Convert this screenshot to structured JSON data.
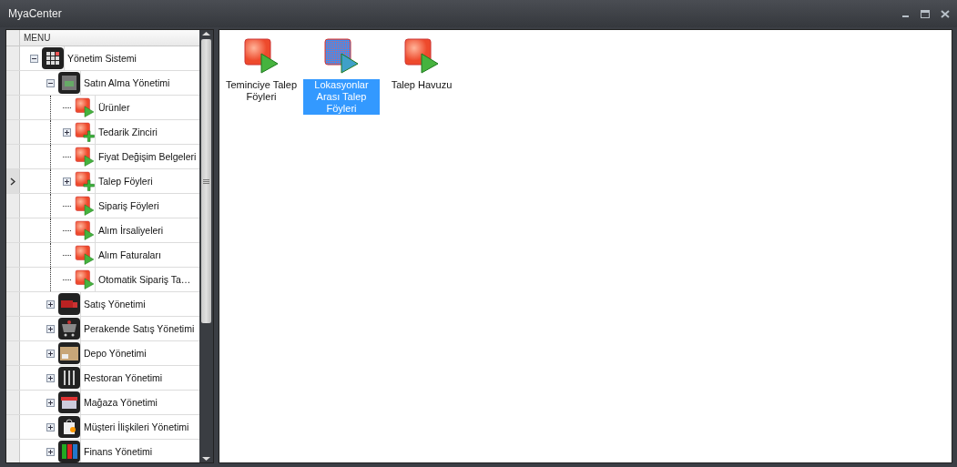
{
  "window": {
    "title": "MyaCenter"
  },
  "menu": {
    "header": "MENU",
    "tree": [
      {
        "label": "Yönetim Sistemi",
        "kind": "module",
        "expanded": true,
        "selected": false,
        "children": [
          {
            "label": "Satın Alma Yönetimi",
            "kind": "module",
            "expanded": true,
            "selected": false,
            "children": [
              {
                "label": "Ürünler",
                "kind": "run",
                "selected": false
              },
              {
                "label": "Tedarik Zinciri",
                "kind": "folder",
                "expanded": false,
                "selected": false
              },
              {
                "label": "Fiyat Değişim Belgeleri",
                "kind": "run",
                "selected": false
              },
              {
                "label": "Talep Föyleri",
                "kind": "folder",
                "expanded": false,
                "selected": true
              },
              {
                "label": "Sipariş Föyleri",
                "kind": "run",
                "selected": false
              },
              {
                "label": "Alım İrsaliyeleri",
                "kind": "run",
                "selected": false
              },
              {
                "label": "Alım Faturaları",
                "kind": "run",
                "selected": false
              },
              {
                "label": "Otomatik Sipariş Ta…",
                "kind": "run",
                "selected": false
              }
            ]
          },
          {
            "label": "Satış Yönetimi",
            "kind": "module",
            "expanded": false,
            "selected": false
          },
          {
            "label": "Perakende Satış Yönetimi",
            "kind": "module",
            "expanded": false,
            "selected": false
          },
          {
            "label": "Depo Yönetimi",
            "kind": "module",
            "expanded": false,
            "selected": false
          },
          {
            "label": "Restoran Yönetimi",
            "kind": "module",
            "expanded": false,
            "selected": false
          },
          {
            "label": "Mağaza Yönetimi",
            "kind": "module",
            "expanded": false,
            "selected": false
          },
          {
            "label": "Müşteri İlişkileri Yönetimi",
            "kind": "module",
            "expanded": false,
            "selected": false
          },
          {
            "label": "Finans Yönetimi",
            "kind": "module",
            "expanded": false,
            "selected": false
          }
        ]
      }
    ]
  },
  "items": [
    {
      "label": "Teminciye Talep Föyleri",
      "selected": false
    },
    {
      "label": "Lokasyonlar Arası Talep Föyleri",
      "selected": true
    },
    {
      "label": "Talep Havuzu",
      "selected": false
    }
  ]
}
